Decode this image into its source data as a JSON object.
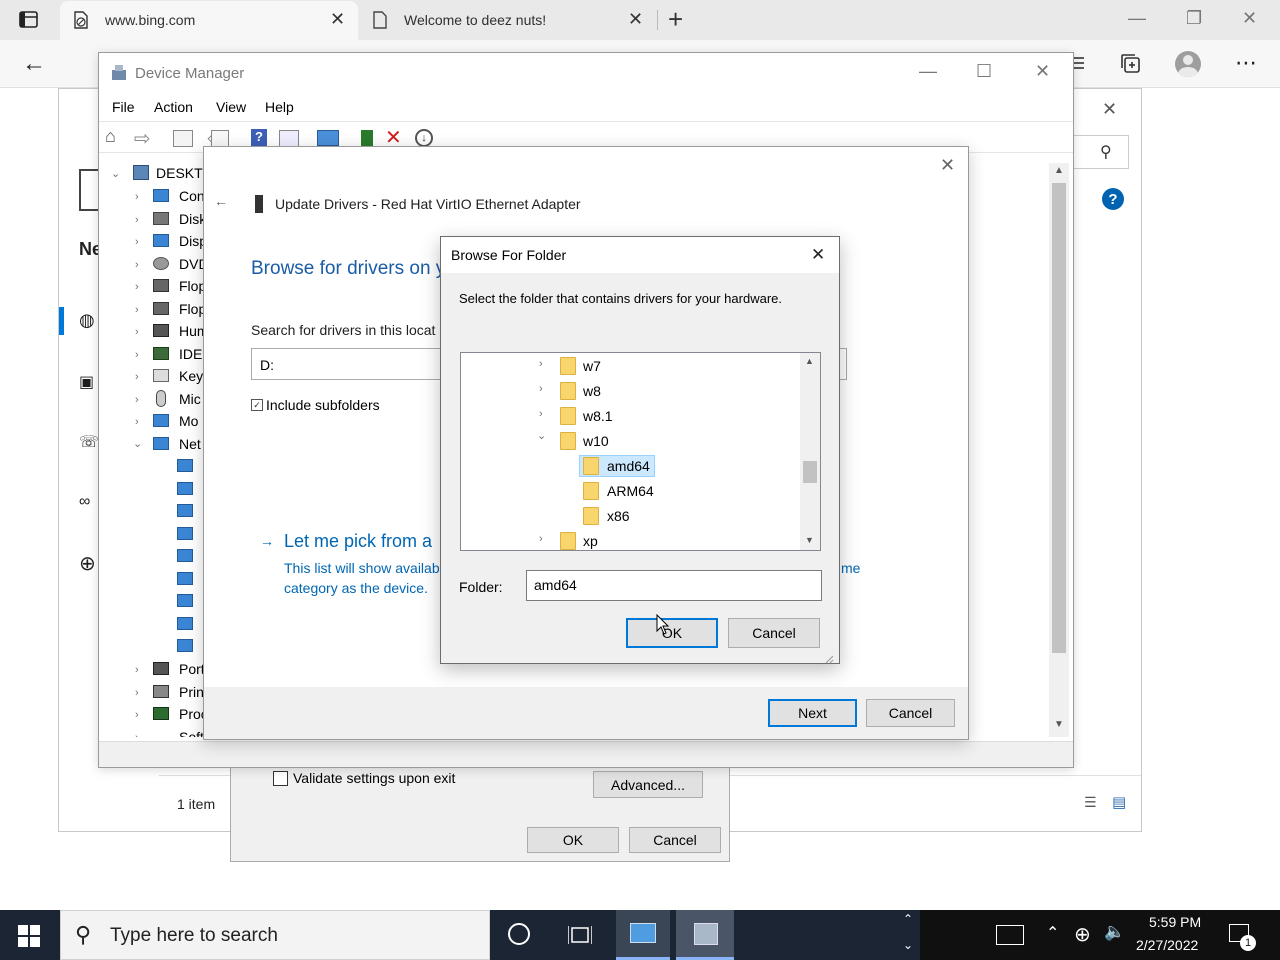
{
  "browser": {
    "tabs": [
      {
        "title": "www.bing.com",
        "icon": "tab-page-icon"
      },
      {
        "title": "Welcome to deez nuts!",
        "icon": "page-icon"
      }
    ],
    "new_tab_glyph": "+"
  },
  "device_manager": {
    "title": "Device Manager",
    "menu": [
      "File",
      "Action",
      "View",
      "Help"
    ],
    "tree_root": "DESKTO",
    "tree_items": [
      "Con",
      "Disk",
      "Disp",
      "DVD",
      "Flop",
      "Flop",
      "Hum",
      "IDE",
      "Key",
      "Mic",
      "Mo",
      "Net"
    ],
    "tree_items_bottom": [
      "Port",
      "Prin",
      "Proc",
      "Soft"
    ]
  },
  "update_drivers": {
    "title": "Update Drivers - Red Hat VirtIO Ethernet Adapter",
    "heading": "Browse for drivers on y",
    "search_label": "Search for drivers in this locat",
    "path_value": "D:",
    "include_subfolders": "Include subfolders",
    "pick_link": "Let me pick from a",
    "pick_desc_line1": "This list will show availab",
    "pick_desc_line2": "category as the device.",
    "pick_desc_tail": "me",
    "next_label": "Next",
    "cancel_label": "Cancel"
  },
  "browse_folder": {
    "title": "Browse For Folder",
    "instruction": "Select the folder that contains drivers for your hardware.",
    "folders": [
      {
        "name": "w7",
        "expander": "›"
      },
      {
        "name": "w8",
        "expander": "›"
      },
      {
        "name": "w8.1",
        "expander": "›"
      },
      {
        "name": "w10",
        "expander": "⌄"
      },
      {
        "name": "amd64",
        "expander": ""
      },
      {
        "name": "ARM64",
        "expander": ""
      },
      {
        "name": "x86",
        "expander": ""
      },
      {
        "name": "xp",
        "expander": "›"
      }
    ],
    "selected_folder": "amd64",
    "folder_label": "Folder:",
    "folder_value": "amd64",
    "ok_label": "OK",
    "cancel_label": "Cancel"
  },
  "properties_dialog": {
    "validate_label": "Validate settings upon exit",
    "advanced_label": "Advanced...",
    "ok_label": "OK",
    "cancel_label": "Cancel"
  },
  "settings_window": {
    "partial_heading": "Ne",
    "item_count": "1 item"
  },
  "taskbar": {
    "search_placeholder": "Type here to search",
    "time": "5:59 PM",
    "date": "2/27/2022",
    "notification_count": "1"
  },
  "colors": {
    "accent": "#0078d7",
    "link_blue": "#0066b4",
    "taskbar_bg": "#1c2533",
    "folder_yellow": "#f9d56e",
    "selection": "#cce8ff"
  }
}
